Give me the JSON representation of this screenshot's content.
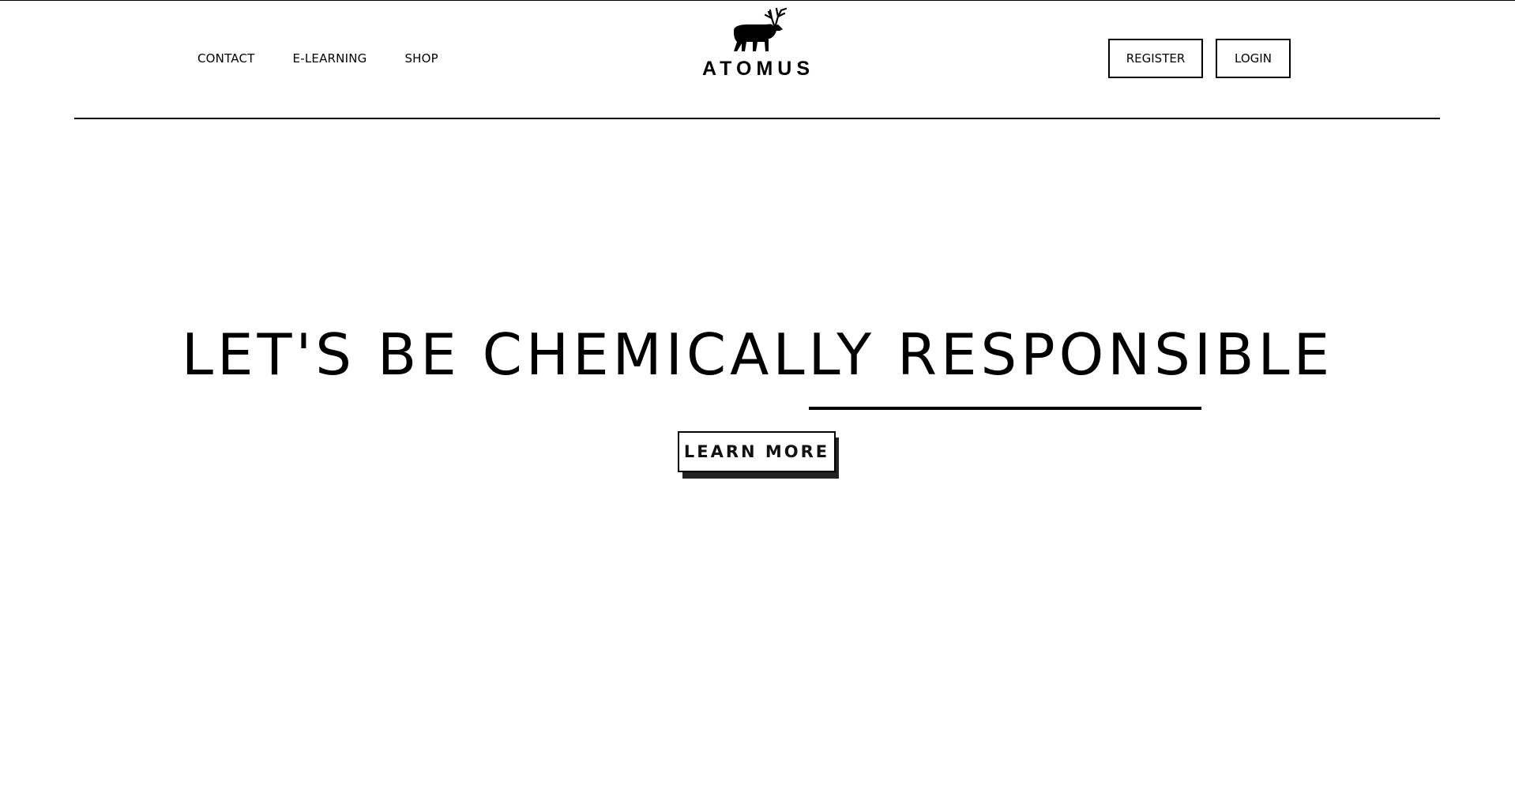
{
  "nav": {
    "links": [
      {
        "label": "CONTACT"
      },
      {
        "label": "E-LEARNING"
      },
      {
        "label": "SHOP"
      }
    ]
  },
  "brand": {
    "name": "ATOMUS",
    "icon": "elk-icon"
  },
  "auth": {
    "register_label": "REGISTER",
    "login_label": "LOGIN"
  },
  "hero": {
    "title": "LET'S BE CHEMICALLY RESPONSIBLE",
    "cta_label": "LEARN MORE"
  },
  "colors": {
    "primary": "#000000",
    "background": "#ffffff",
    "shadow": "#222222"
  }
}
